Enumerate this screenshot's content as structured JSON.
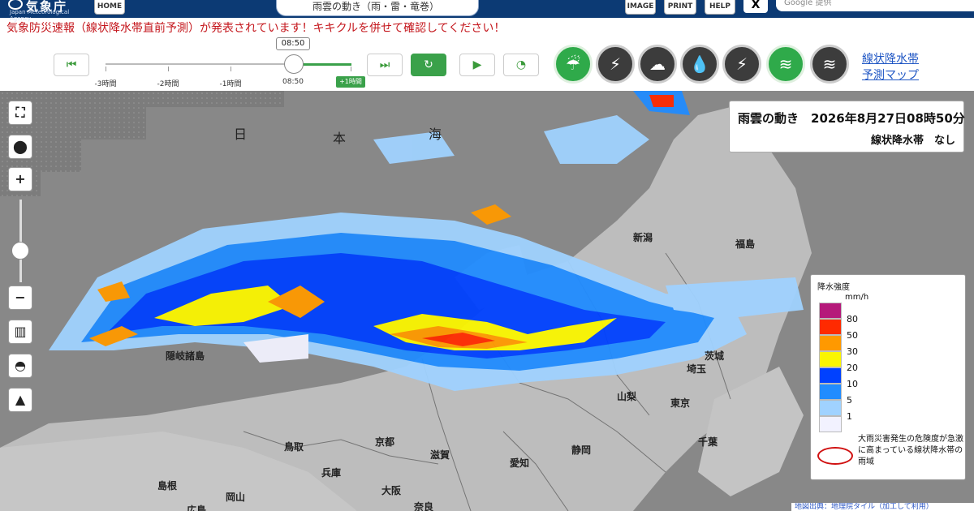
{
  "header": {
    "logo_name": "気象庁",
    "logo_en": "Japan Meteorological Agency",
    "home_label": "HOME",
    "page_title": "雨雲の動き（雨・雷・竜巻）",
    "image_label": "IMAGE",
    "print_label": "PRINT",
    "help_label": "HELP",
    "x_label": "X",
    "search_placeholder": "Google 提供"
  },
  "alert": "気象防災速報（線状降水帯直前予測）が発表されています！キキクルを併せて確認してください！",
  "timeline": {
    "current_time": "08:50",
    "labels": [
      "-3時間",
      "-2時間",
      "-1時間",
      "08:50"
    ],
    "future_badge": "+1時間",
    "first_icon": "skip-to-start-icon",
    "last_icon": "skip-to-end-icon",
    "reload_icon": "reload-icon",
    "play_icon": "play-icon",
    "speed_icon": "speed-gauge-icon"
  },
  "layers": [
    {
      "name": "rain-cloud-icon",
      "glyph": "☔",
      "active": true
    },
    {
      "name": "thunder-cloud-icon",
      "glyph": "⚡",
      "active": false
    },
    {
      "name": "tornado-cloud-icon",
      "glyph": "☁",
      "active": false
    },
    {
      "name": "rain-drop-icon",
      "glyph": "💧",
      "active": false
    },
    {
      "name": "lightning-icon",
      "glyph": "⚡",
      "active": false
    },
    {
      "name": "linear-rainband-icon",
      "glyph": "≋",
      "active": true
    },
    {
      "name": "linear-rainband-forecast-icon",
      "glyph": "≋",
      "active": false
    }
  ],
  "link": {
    "line1": "線状降水帯",
    "line2": "予測マップ"
  },
  "map_tools": {
    "fullscreen_icon": "fullscreen-icon",
    "location_icon": "location-pin-icon",
    "zoom_in": "+",
    "zoom_out": "−",
    "map_icon": "map-icon",
    "drop_icon": "water-drop-icon",
    "terrain_icon": "mountain-icon"
  },
  "infobox": {
    "title": "雨雲の動き　2026年8月27日08時50分",
    "subtitle": "線状降水帯　なし"
  },
  "legend": {
    "title": "降水強度",
    "unit": "mm/h",
    "levels": [
      {
        "label": "80",
        "color": "#b5197a"
      },
      {
        "label": "50",
        "color": "#ff2a00"
      },
      {
        "label": "30",
        "color": "#ff9900"
      },
      {
        "label": "20",
        "color": "#faf500"
      },
      {
        "label": "10",
        "color": "#0041ff"
      },
      {
        "label": "5",
        "color": "#218cff"
      },
      {
        "label": "1",
        "color": "#a0d2ff"
      },
      {
        "label": "",
        "color": "#f2f2ff"
      }
    ],
    "description": "大雨災害発生の危険度が急激に高まっている線状降水帯の雨域"
  },
  "places": [
    {
      "label": "日",
      "color": "#333"
    },
    {
      "label": "本",
      "color": "#333"
    },
    {
      "label": "海",
      "color": "#333"
    },
    {
      "label": "新潟",
      "color": "#222"
    },
    {
      "label": "福島",
      "color": "#222"
    },
    {
      "label": "隠岐諸島",
      "color": "#222"
    },
    {
      "label": "鳥取",
      "color": "#222"
    },
    {
      "label": "岡山",
      "color": "#222"
    },
    {
      "label": "広島",
      "color": "#222"
    },
    {
      "label": "島根",
      "color": "#222"
    },
    {
      "label": "兵庫",
      "color": "#222"
    },
    {
      "label": "京都",
      "color": "#222"
    },
    {
      "label": "大阪",
      "color": "#222"
    },
    {
      "label": "奈良",
      "color": "#222"
    },
    {
      "label": "愛知",
      "color": "#222"
    },
    {
      "label": "静岡",
      "color": "#222"
    },
    {
      "label": "山梨",
      "color": "#222"
    },
    {
      "label": "埼玉",
      "color": "#222"
    },
    {
      "label": "茨城",
      "color": "#222"
    },
    {
      "label": "千葉",
      "color": "#222"
    },
    {
      "label": "東京",
      "color": "#222"
    },
    {
      "label": "滋賀",
      "color": "#222"
    }
  ],
  "credit": "地図出典：地理院タイル（加工して利用）"
}
